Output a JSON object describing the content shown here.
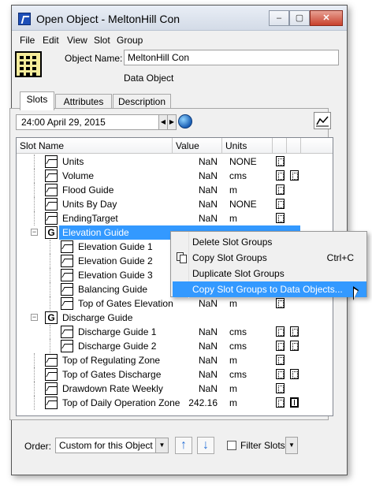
{
  "window": {
    "title": "Open Object - MeltonHill Con",
    "min_label": "–",
    "max_label": "▢",
    "close_label": "✕"
  },
  "menu": [
    "File",
    "Edit",
    "View",
    "Slot",
    "Group"
  ],
  "object": {
    "name_label": "Object Name:",
    "name_value": "MeltonHill Con",
    "type": "Data Object"
  },
  "tabs": [
    "Slots",
    "Attributes",
    "Description"
  ],
  "timestep": "24:00 April 29, 2015",
  "columns": [
    "Slot Name",
    "Value",
    "Units"
  ],
  "rows": [
    {
      "name": "Units",
      "value": "NaN",
      "units": "NONE",
      "kind": "slot",
      "level": 0
    },
    {
      "name": "Volume",
      "value": "NaN",
      "units": "cms",
      "kind": "slot",
      "level": 0
    },
    {
      "name": "Flood Guide",
      "value": "NaN",
      "units": "m",
      "kind": "slot",
      "level": 0
    },
    {
      "name": "Units By Day",
      "value": "NaN",
      "units": "NONE",
      "kind": "slot",
      "level": 0
    },
    {
      "name": "EndingTarget",
      "value": "NaN",
      "units": "m",
      "kind": "slot",
      "level": 0
    },
    {
      "name": "Elevation Guide",
      "value": "",
      "units": "",
      "kind": "group",
      "level": 0,
      "selected": true
    },
    {
      "name": "Elevation Guide 1",
      "value": "",
      "units": "",
      "kind": "slot",
      "level": 1
    },
    {
      "name": "Elevation Guide 2",
      "value": "",
      "units": "",
      "kind": "slot",
      "level": 1
    },
    {
      "name": "Elevation Guide 3",
      "value": "",
      "units": "",
      "kind": "slot",
      "level": 1
    },
    {
      "name": "Balancing Guide",
      "value": "",
      "units": "",
      "kind": "slot",
      "level": 1
    },
    {
      "name": "Top of Gates Elevation",
      "value": "NaN",
      "units": "m",
      "kind": "slot",
      "level": 1
    },
    {
      "name": "Discharge Guide",
      "value": "",
      "units": "",
      "kind": "group",
      "level": 0
    },
    {
      "name": "Discharge Guide 1",
      "value": "NaN",
      "units": "cms",
      "kind": "slot",
      "level": 1
    },
    {
      "name": "Discharge Guide 2",
      "value": "NaN",
      "units": "cms",
      "kind": "slot",
      "level": 1
    },
    {
      "name": "Top of Regulating Zone",
      "value": "NaN",
      "units": "m",
      "kind": "slot",
      "level": 0
    },
    {
      "name": "Top of Gates Discharge",
      "value": "NaN",
      "units": "cms",
      "kind": "slot",
      "level": 0
    },
    {
      "name": "Drawdown Rate Weekly",
      "value": "NaN",
      "units": "m",
      "kind": "slot",
      "level": 0
    },
    {
      "name": "Top of Daily Operation Zone",
      "value": "242.16",
      "units": "m",
      "kind": "slot",
      "level": 0
    }
  ],
  "context_menu": [
    {
      "label": "Delete Slot Groups",
      "shortcut": ""
    },
    {
      "label": "Copy Slot Groups",
      "shortcut": "Ctrl+C"
    },
    {
      "label": "Duplicate Slot Groups",
      "shortcut": ""
    },
    {
      "label": "Copy Slot Groups to Data Objects...",
      "shortcut": ""
    }
  ],
  "footer": {
    "order_label": "Order:",
    "order_value": "Custom for this Object",
    "filter_label": "Filter Slots"
  },
  "colors": {
    "selection": "#3399ff",
    "object_icon": "#f6ec9a"
  }
}
